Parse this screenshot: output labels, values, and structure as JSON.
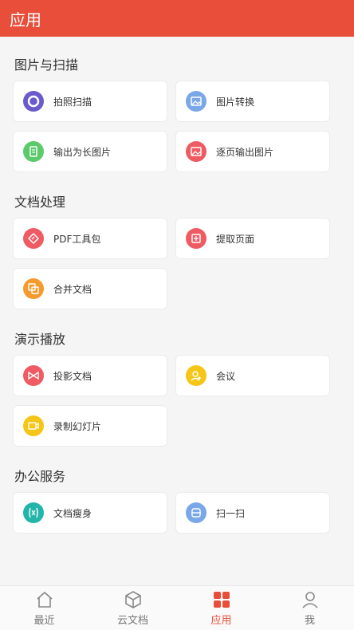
{
  "header": {
    "title": "应用"
  },
  "sections": [
    {
      "title": "图片与扫描",
      "items": [
        {
          "label": "拍照扫描",
          "icon": "camera-scan-icon",
          "color": "#6a5acd"
        },
        {
          "label": "图片转换",
          "icon": "image-convert-icon",
          "color": "#7aa7e8"
        },
        {
          "label": "输出为长图片",
          "icon": "long-image-icon",
          "color": "#5cc96a"
        },
        {
          "label": "逐页输出图片",
          "icon": "page-image-icon",
          "color": "#ef5b63"
        }
      ]
    },
    {
      "title": "文档处理",
      "items": [
        {
          "label": "PDF工具包",
          "icon": "pdf-toolkit-icon",
          "color": "#ef5b63"
        },
        {
          "label": "提取页面",
          "icon": "extract-page-icon",
          "color": "#ef5b63"
        },
        {
          "label": "合并文档",
          "icon": "merge-docs-icon",
          "color": "#f59a2e"
        }
      ]
    },
    {
      "title": "演示播放",
      "items": [
        {
          "label": "投影文档",
          "icon": "projection-icon",
          "color": "#ef5b63"
        },
        {
          "label": "会议",
          "icon": "meeting-icon",
          "color": "#f5c518"
        },
        {
          "label": "录制幻灯片",
          "icon": "record-slides-icon",
          "color": "#f5c518"
        }
      ]
    },
    {
      "title": "办公服务",
      "items": [
        {
          "label": "文档瘦身",
          "icon": "slim-doc-icon",
          "color": "#23b5a9"
        },
        {
          "label": "扫一扫",
          "icon": "scan-qr-icon",
          "color": "#7aa7e8"
        }
      ]
    }
  ],
  "tabbar": {
    "items": [
      {
        "label": "最近",
        "icon": "home-icon"
      },
      {
        "label": "云文档",
        "icon": "cloud-doc-icon"
      },
      {
        "label": "应用",
        "icon": "apps-icon",
        "active": true
      },
      {
        "label": "我",
        "icon": "user-icon"
      }
    ]
  },
  "colors": {
    "accent": "#e84e3a",
    "background": "#f5f5f5"
  }
}
